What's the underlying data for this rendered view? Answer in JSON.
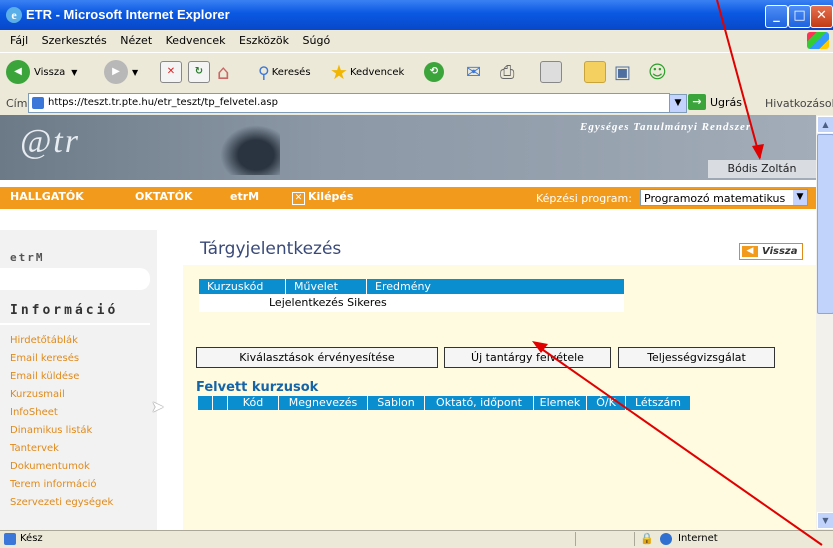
{
  "window": {
    "title": "ETR - Microsoft Internet Explorer"
  },
  "menu": [
    "Fájl",
    "Szerkesztés",
    "Nézet",
    "Kedvencek",
    "Eszközök",
    "Súgó"
  ],
  "toolbar": {
    "back": "Vissza",
    "search": "Keresés",
    "favorites": "Kedvencek"
  },
  "address": {
    "label": "Cím",
    "url": "https://teszt.tr.pte.hu/etr_teszt/tp_felvetel.asp",
    "go": "Ugrás",
    "links": "Hivatkozások"
  },
  "banner": {
    "logo": "@tr",
    "title": "Egységes Tanulmányi Rendszer",
    "user": "Bódis Zoltán"
  },
  "nav": {
    "items": [
      "HALLGATÓK",
      "OKTATÓK",
      "etrM",
      "Kilépés"
    ],
    "program_label": "Képzési program:",
    "program_value": "Programozó matematikus"
  },
  "sidebar": {
    "section1": "etrM",
    "section2": "Információ",
    "links": [
      "Hirdetőtáblák",
      "Email keresés",
      "Email küldése",
      "Kurzusmail",
      "InfoSheet",
      "Dinamikus listák",
      "Tantervek",
      "Dokumentumok",
      "Terem információ",
      "Szervezeti egységek"
    ]
  },
  "main": {
    "title": "Tárgyjelentkezés",
    "back_button": "Vissza",
    "result_table": {
      "headers": [
        "Kurzuskód",
        "Művelet",
        "Eredmény"
      ],
      "message": "Lejelentkezés Sikeres"
    },
    "buttons": [
      "Kiválasztások érvényesítése",
      "Új tantárgy felvétele",
      "Teljességvizsgálat"
    ],
    "courses_title": "Felvett kurzusok",
    "courses_headers": [
      "",
      "",
      "Kód",
      "Megnevezés",
      "Sablon",
      "Oktató, időpont",
      "Elemek",
      "Ó/K",
      "Létszám"
    ]
  },
  "status": {
    "text": "Kész",
    "zone": "Internet"
  },
  "colors": {
    "nav_orange": "#F29A1C",
    "table_blue": "#0A8ED0",
    "link_orange": "#E08A1A",
    "arrow_red": "#E00000"
  }
}
